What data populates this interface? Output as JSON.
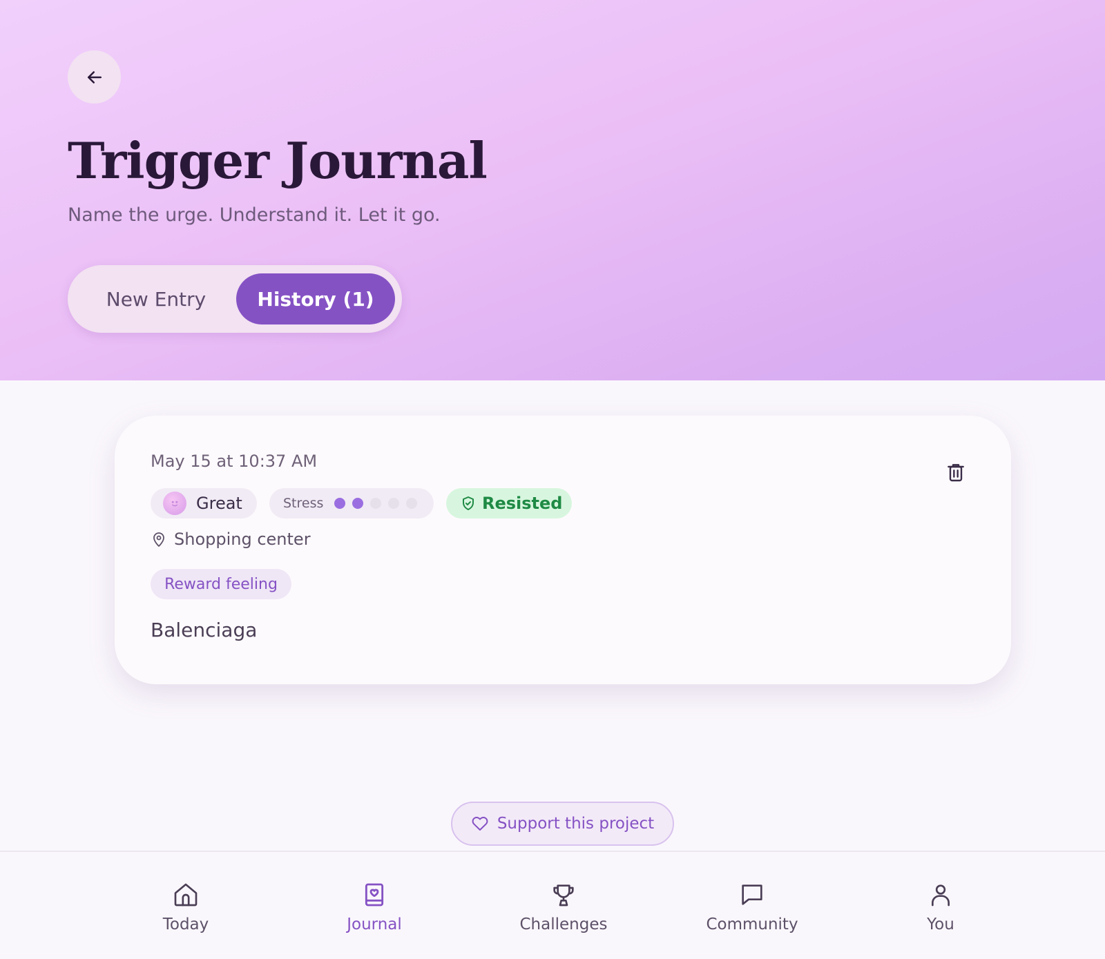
{
  "header": {
    "title": "Trigger Journal",
    "subtitle": "Name the urge. Understand it. Let it go."
  },
  "tabs": {
    "new_entry": "New Entry",
    "history": "History (1)",
    "active": "history"
  },
  "entries": [
    {
      "date": "May 15 at 10:37 AM",
      "mood": "Great",
      "stress_label": "Stress",
      "stress_level": 2,
      "stress_max": 5,
      "outcome": "Resisted",
      "location": "Shopping center",
      "trigger_tag": "Reward feeling",
      "note": "Balenciaga"
    }
  ],
  "support": {
    "label": "Support this project"
  },
  "nav": {
    "active": "journal",
    "items": [
      {
        "id": "today",
        "label": "Today",
        "icon": "home-icon"
      },
      {
        "id": "journal",
        "label": "Journal",
        "icon": "journal-icon"
      },
      {
        "id": "challenges",
        "label": "Challenges",
        "icon": "trophy-icon"
      },
      {
        "id": "community",
        "label": "Community",
        "icon": "chat-icon"
      },
      {
        "id": "you",
        "label": "You",
        "icon": "user-icon"
      }
    ]
  },
  "colors": {
    "accent": "#8552c4",
    "resisted_bg": "#d8f6df",
    "resisted_text": "#1f8a45",
    "stress_dot_on": "#9a6ee0",
    "stress_dot_off": "#e6e0ea"
  }
}
